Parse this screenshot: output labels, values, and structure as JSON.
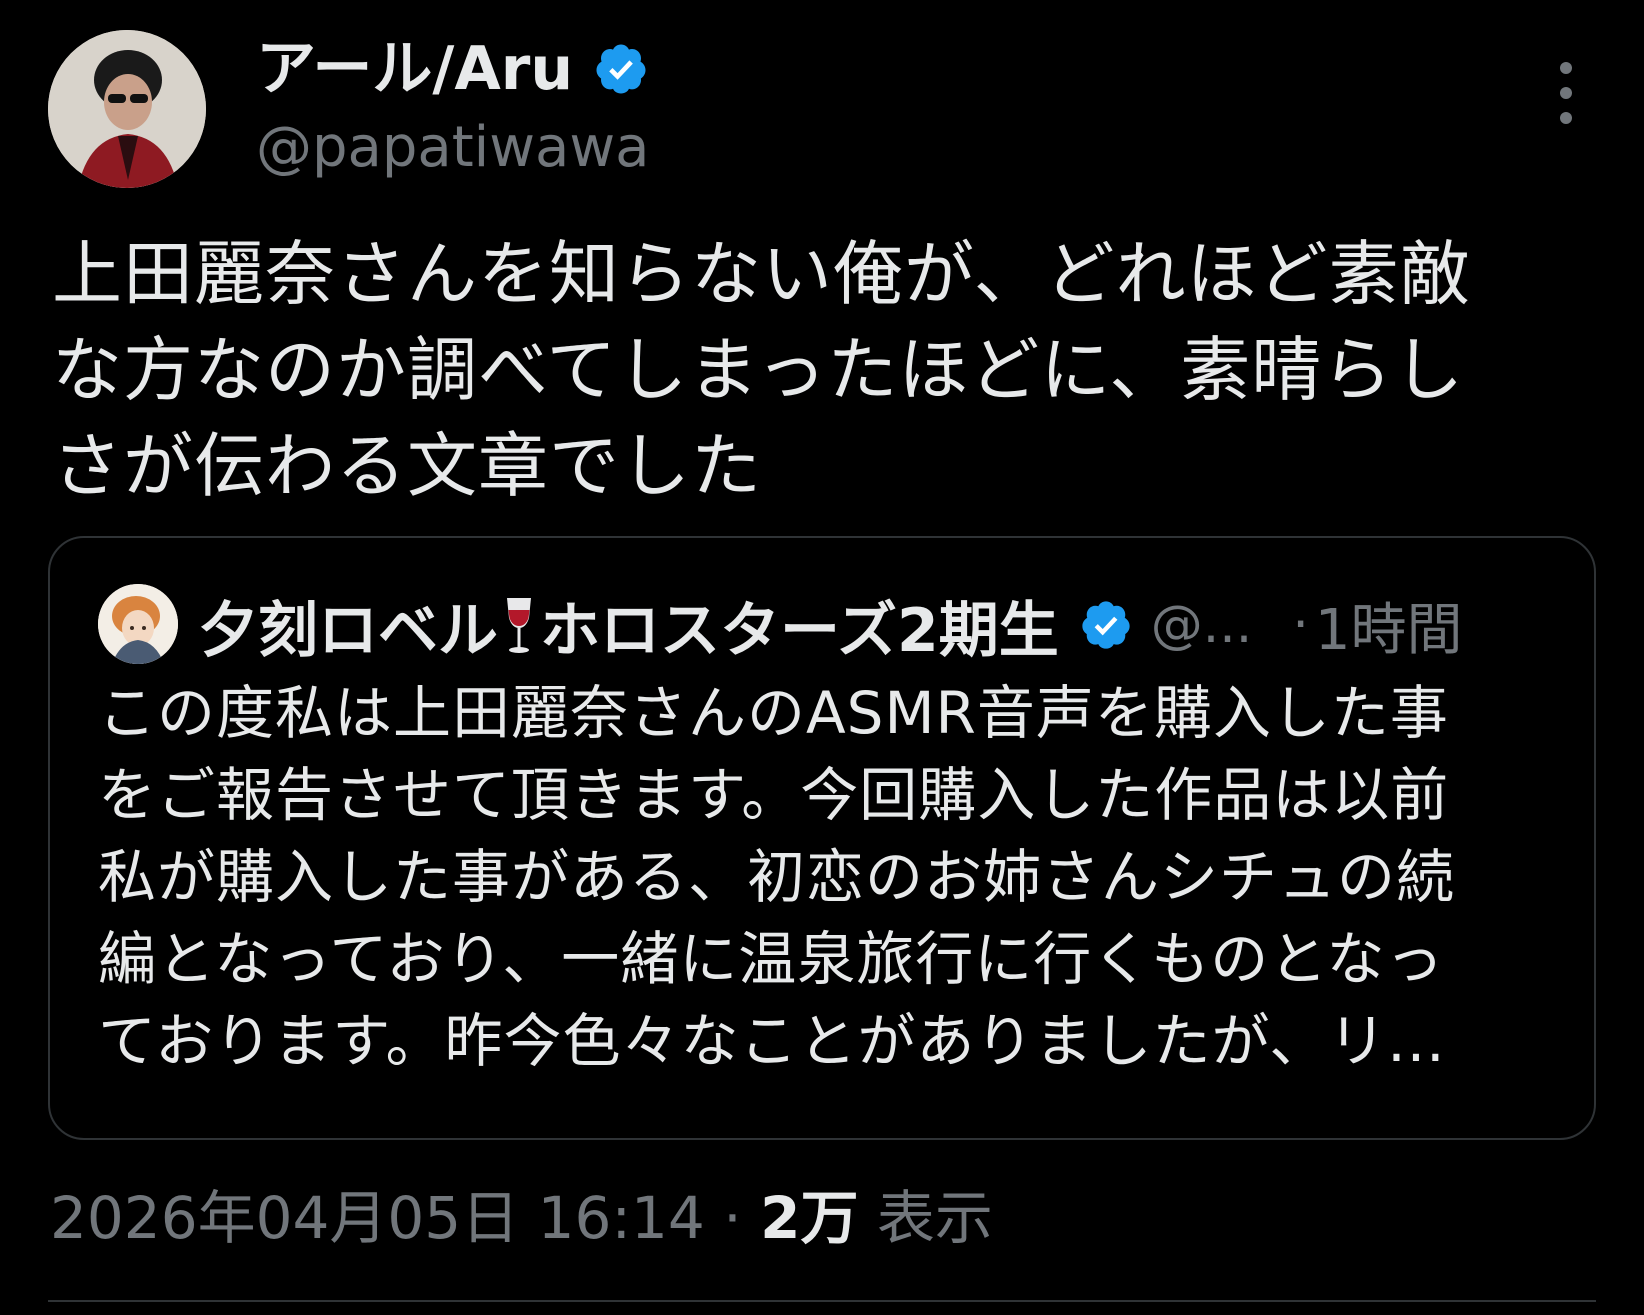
{
  "author": {
    "display_name": "アール/Aru",
    "handle": "@papatiwawa",
    "verified": true
  },
  "tweet": {
    "text": "上田麗奈さんを知らない俺が、どれほど素敵\nな方なのか調べてしまったほどに、素晴らし\nさが伝わる文章でした"
  },
  "quote": {
    "display_name_a": "夕刻ロベル",
    "display_name_b": "ホロスターズ2期生",
    "handle": "@...",
    "separator": "·",
    "time": "1時間",
    "text": "この度私は上田麗奈さんのASMR音声を購入した事\nをご報告させて頂きます。今回購入した作品は以前\n私が購入した事がある、初恋のお姉さんシチュの続\n編となっており、一緒に温泉旅行に行くものとなっ\nております。昨今色々なことがありましたが、リ..."
  },
  "meta": {
    "timestamp": "2026年04月05日 16:14",
    "separator": "·",
    "views_count": "2万",
    "views_label": "表示"
  },
  "colors": {
    "background": "#000000",
    "text": "#e7e9ea",
    "secondary": "#71767b",
    "verified_blue": "#1d9bf0",
    "border": "#2f3336"
  },
  "icons": {
    "verified": "verified-badge-icon",
    "more": "more-horizontal-icon",
    "wine": "wine-glass-icon"
  }
}
